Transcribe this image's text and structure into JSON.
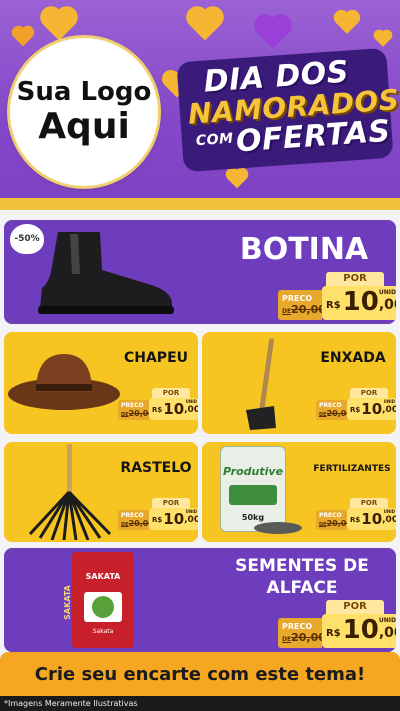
{
  "header": {
    "logo_line1": "Sua Logo",
    "logo_line2": "Aqui",
    "event_line1": "DIA DOS",
    "event_line2": "NAMORADOS",
    "event_com": "COM",
    "event_line3": "OFERTAS"
  },
  "colors": {
    "purple": "#6e3dbd",
    "yellow": "#f6c521",
    "orange": "#f6a721"
  },
  "products": [
    {
      "id": "botina",
      "name": "BOTINA",
      "discount": "-50%",
      "price_label": "PRECO",
      "old_prefix": "DE",
      "old_price": "20,00",
      "por_label": "POR",
      "currency": "R$",
      "price_int": "10",
      "price_dec": ",00",
      "unit": "UNID",
      "icon": "boot-icon"
    },
    {
      "id": "chapeu",
      "name": "CHAPEU",
      "price_label": "PRECO",
      "old_prefix": "DE",
      "old_price": "20,00",
      "por_label": "POR",
      "currency": "R$",
      "price_int": "10",
      "price_dec": ",00",
      "unit": "UNID",
      "icon": "hat-icon"
    },
    {
      "id": "enxada",
      "name": "ENXADA",
      "price_label": "PRECO",
      "old_prefix": "DE",
      "old_price": "20,00",
      "por_label": "POR",
      "currency": "R$",
      "price_int": "10",
      "price_dec": ",00",
      "unit": "UNID",
      "icon": "hoe-icon"
    },
    {
      "id": "rastelo",
      "name": "RASTELO",
      "price_label": "PRECO",
      "old_prefix": "DE",
      "old_price": "20,00",
      "por_label": "POR",
      "currency": "R$",
      "price_int": "10",
      "price_dec": ",00",
      "unit": "UNID",
      "icon": "rake-icon"
    },
    {
      "id": "fertilizantes",
      "name": "FERTILIZANTES",
      "bag_brand": "Produtive",
      "bag_weight": "50kg",
      "price_label": "PRECO",
      "old_prefix": "DE",
      "old_price": "20,00",
      "por_label": "POR",
      "currency": "R$",
      "price_int": "10",
      "price_dec": ",00",
      "unit": "UNID",
      "icon": "fertilizer-bag-icon"
    },
    {
      "id": "sementes",
      "name_line1": "SEMENTES DE",
      "name_line2": "ALFACE",
      "pack_brand": "SAKATA",
      "pack_side": "SAKATA",
      "pack_small": "Sakata",
      "price_label": "PRECO",
      "old_prefix": "DE",
      "old_price": "20,00",
      "por_label": "POR",
      "currency": "R$",
      "price_int": "10",
      "price_dec": ",00",
      "unit": "UNID",
      "icon": "seed-packet-icon"
    }
  ],
  "footer": {
    "cta": "Crie seu encarte com este tema!",
    "disclaimer": "*Imagens Meramente Ilustrativas"
  }
}
